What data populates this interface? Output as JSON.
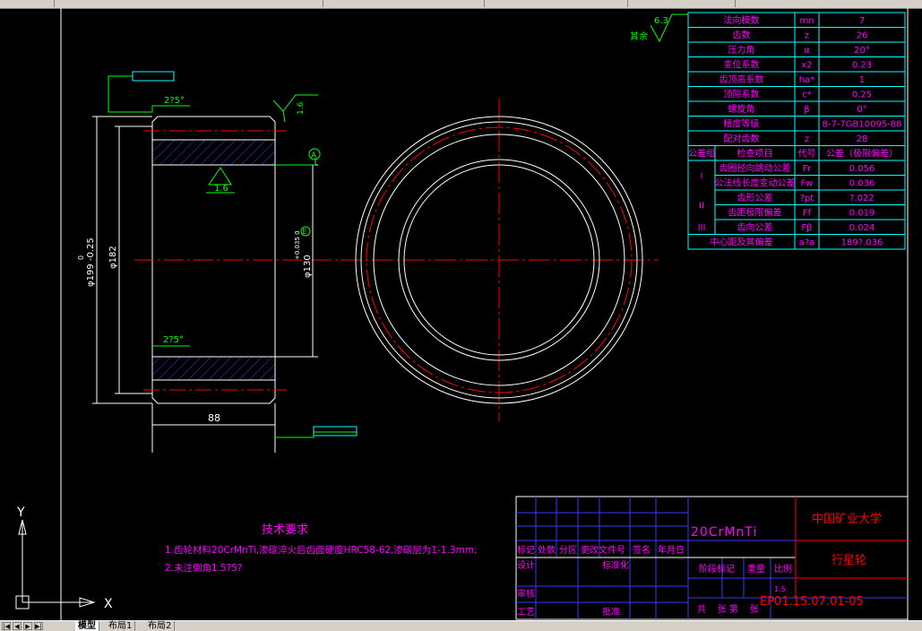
{
  "window": {
    "top_tabs": [
      "",
      "",
      "",
      "",
      ""
    ]
  },
  "drawing": {
    "roughness_other": "6.3",
    "roughness_other_label": "其余",
    "roughness_face": "1.6",
    "roughness_bore": "1.6",
    "chamfer_top": "2?5°",
    "chamfer_bottom": "2?5°",
    "datum": "A",
    "tolerance_symbol": "E",
    "dim_outer": "φ199 -0.25",
    "dim_outer_upper": "0",
    "dim_middle": "φ182",
    "dim_bore": "φ130",
    "dim_bore_tol": "+0.035 0",
    "dim_width": "88"
  },
  "param_table": {
    "rows": [
      {
        "name": "法向模数",
        "sym": "mn",
        "val": "7"
      },
      {
        "name": "齿数",
        "sym": "z",
        "val": "26"
      },
      {
        "name": "压力角",
        "sym": "α",
        "val": "20°"
      },
      {
        "name": "变位系数",
        "sym": "x2",
        "val": "0.23"
      },
      {
        "name": "齿顶高系数",
        "sym": "ha*",
        "val": "1"
      },
      {
        "name": "顶隙系数",
        "sym": "c*",
        "val": "0.25"
      },
      {
        "name": "螺旋角",
        "sym": "β",
        "val": "0°"
      },
      {
        "name": "精度等级",
        "sym": "",
        "val": "8-7-7GB10095-88"
      },
      {
        "name": "配对齿数",
        "sym": "z",
        "val": "28"
      }
    ],
    "header": {
      "group": "公差组",
      "item": "检查项目",
      "code": "代号",
      "tol": "公差（极限偏差）"
    },
    "tol_rows": [
      {
        "group": "I",
        "item": "齿圈径向跳动公差",
        "code": "Fr",
        "val": "0.056"
      },
      {
        "group": "",
        "item": "公法线长度变动公差",
        "code": "Fw",
        "val": "0.036"
      },
      {
        "group": "II",
        "item": "齿形公差",
        "code": "?pt",
        "val": "?.022"
      },
      {
        "group": "",
        "item": "齿距极限偏差",
        "code": "Ff",
        "val": "0.019"
      },
      {
        "group": "III",
        "item": "齿向公差",
        "code": "Fβ",
        "val": "0.024"
      }
    ],
    "last_row": {
      "item": "中心距及其偏差",
      "code": "a?a",
      "val": "189?.036"
    }
  },
  "tech_requirements": {
    "title": "技术要求",
    "line1": "1.齿轮材料20CrMnTi,渗碳淬火后齿面硬度HRC58-62,渗碳层为1-1.3mm;",
    "line2": "2.未注倒角1.5?5?"
  },
  "title_block": {
    "material": "20CrMnTi",
    "university": "中国矿业大学",
    "part_name": "行星轮",
    "drawing_no": "EP01.15.07.01-05",
    "col_headers": [
      "标记",
      "处数",
      "分区",
      "更改文件号",
      "签名",
      "年月日"
    ],
    "design": "设计",
    "standardize": "标准化",
    "check": "审核",
    "process": "工艺",
    "approve": "批准",
    "stage_mark": "阶段标记",
    "weight": "重量",
    "scale": "比例",
    "scale_val": "1.5",
    "sheets": "共    张 第    张"
  },
  "ucs": {
    "y_label": "Y",
    "x_label": "X"
  },
  "layout_tabs": [
    "模型",
    "布局1",
    "布局2"
  ],
  "nav_icons": [
    "nav-first-icon",
    "nav-prev-icon",
    "nav-next-icon",
    "nav-last-icon"
  ],
  "colors": {
    "line_white": "#ffffff",
    "center_red": "#ff0000",
    "dim_green": "#00ff00",
    "table_cyan": "#00ffff",
    "text_magenta": "#ff00ff",
    "hatch_blue": "#0000ff",
    "title_red": "#ff0000",
    "title_blue": "#0000ff"
  }
}
